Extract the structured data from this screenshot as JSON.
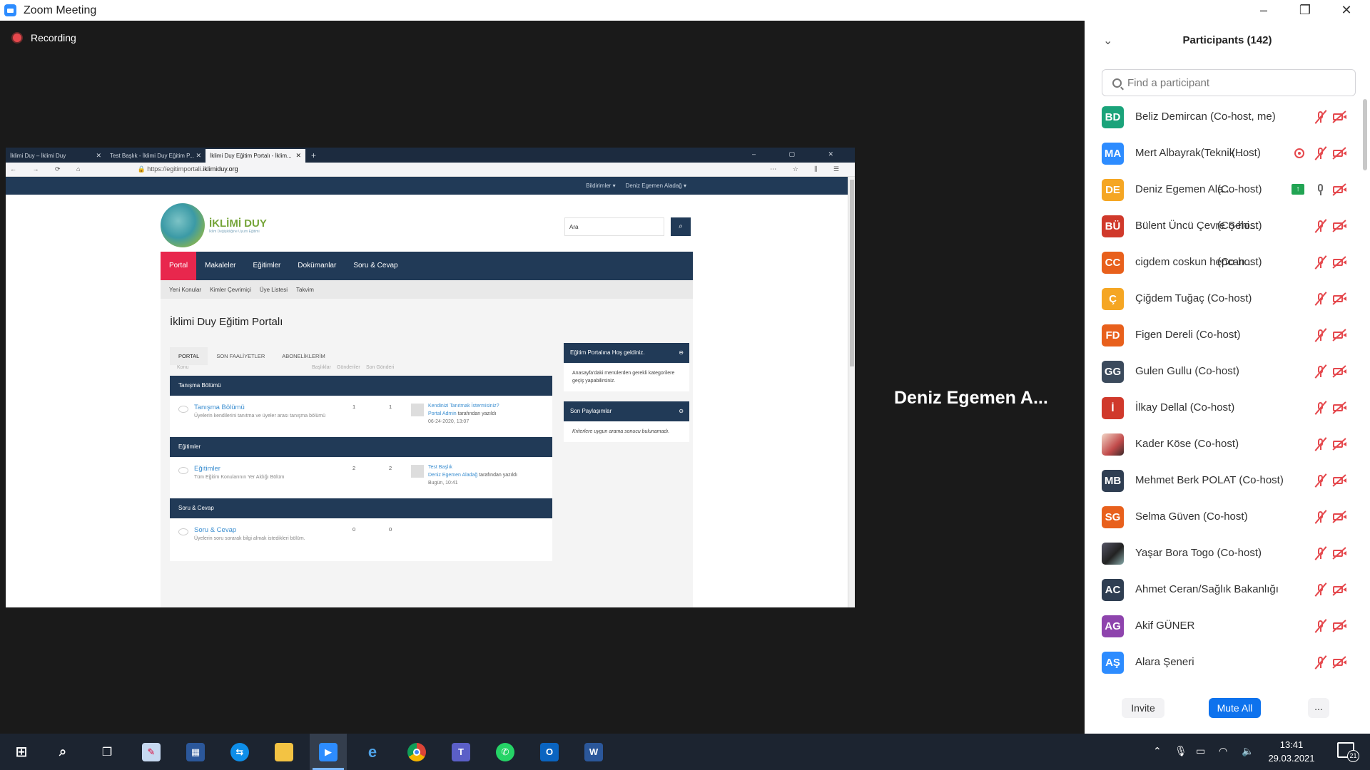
{
  "window": {
    "app_icon": "zoom-icon",
    "title": "Zoom Meeting",
    "controls": [
      "minimize-icon",
      "restore-icon",
      "close-icon"
    ]
  },
  "meeting": {
    "recording_label": "Recording",
    "active_speaker": "Deniz Egemen A..."
  },
  "shared_screen": {
    "tabs": [
      {
        "label": "İklimi Duy – İklimi Duy",
        "active": false
      },
      {
        "label": "Test Başlık - İklimi Duy Eğitim P...",
        "active": false
      },
      {
        "label": "İklimi Duy Eğitim Portalı - İklim...",
        "active": true
      }
    ],
    "url_prefix": "https://egitimportali.",
    "url_domain": "iklimiduy.org",
    "top_nav": {
      "notifications": "Bildirimler ▾",
      "user": "Deniz Egemen Aladağ ▾"
    },
    "logo": {
      "title": "İKLİMİ DUY",
      "tagline": "İklim Değişikliğine Uyum Eğitimi"
    },
    "search_value": "Ara",
    "main_nav": [
      "Portal",
      "Makaleler",
      "Eğitimler",
      "Dokümanlar",
      "Soru & Cevap"
    ],
    "sub_nav": [
      "Yeni Konular",
      "Kimler Çevrimiçi",
      "Üye Listesi",
      "Takvim"
    ],
    "page_title": "İklimi Duy Eğitim Portalı",
    "portal_tabs": [
      "PORTAL",
      "SON FAALİYETLER",
      "ABONELİKLERİM"
    ],
    "columns": [
      "Konu",
      "Başlıklar",
      "Gönderiler",
      "Son Gönderi"
    ],
    "sections": [
      {
        "title": "Tanışma Bölümü",
        "forum": "Tanışma Bölümü",
        "desc": "Üyelerin kendilerini tanıtma ve üyeler arası tanışma bölümü",
        "topics": "1",
        "posts": "1",
        "last_title": "Kendinizi Tanıtmak İstermisiniz?",
        "last_author": "Portal Admin",
        "last_by": "tarafından yazıldı",
        "last_date": "06-24-2020, 13:07"
      },
      {
        "title": "Eğitimler",
        "forum": "Eğitimler",
        "desc": "Tüm Eğitim Konularının Yer Aldığı Bölüm",
        "topics": "2",
        "posts": "2",
        "last_title": "Test Başlık",
        "last_author": "Deniz Egemen Aladağ",
        "last_by": "tarafından yazıldı",
        "last_date": "Bugün, 10:41"
      },
      {
        "title": "Soru & Cevap",
        "forum": "Soru & Cevap",
        "desc": "Üyelerin soru sorarak bilgi almak istedikleri bölüm.",
        "topics": "0",
        "posts": "0",
        "last_title": "",
        "last_author": "",
        "last_by": "",
        "last_date": ""
      }
    ],
    "sidebar": [
      {
        "title": "Eğitim Portalına Hoş geldiniz.",
        "body": "Anasayfa'daki menülerden gerekli kategorilere geçiş yapabilirsiniz."
      },
      {
        "title": "Son Paylaşımlar",
        "body": "Kriterlere uygun arama sonucu bulunamadı."
      }
    ]
  },
  "participants_panel": {
    "title": "Participants (142)",
    "search_placeholder": "Find a participant",
    "participants": [
      {
        "initials": "BD",
        "color": "#1aa37a",
        "name": "Beliz Demircan (Co-host, me)",
        "role": "",
        "mic": "muted",
        "extra": ""
      },
      {
        "initials": "MA",
        "color": "#2d8cff",
        "name": "Mert Albayrak(Teknik ...",
        "role": "(Host)",
        "mic": "muted",
        "extra": "recording"
      },
      {
        "initials": "DE",
        "color": "#f5a623",
        "name": "Deniz Egemen Ala...",
        "role": "(Co-host)",
        "mic": "on",
        "extra": "sharing"
      },
      {
        "initials": "BÜ",
        "color": "#d0392b",
        "name": "Bülent Üncü Çevre Şehi...",
        "role": "(Co-host)",
        "mic": "muted",
        "extra": ""
      },
      {
        "initials": "CC",
        "color": "#e8601c",
        "name": "cigdem coskun hepcan...",
        "role": "(Co-host)",
        "mic": "muted",
        "extra": ""
      },
      {
        "initials": "Ç",
        "color": "#f5a623",
        "name": "Çiğdem Tuğaç (Co-host)",
        "role": "",
        "mic": "muted",
        "extra": ""
      },
      {
        "initials": "FD",
        "color": "#e8601c",
        "name": "Figen Dereli (Co-host)",
        "role": "",
        "mic": "muted",
        "extra": ""
      },
      {
        "initials": "GG",
        "color": "#3b4a5c",
        "name": "Gulen Gullu (Co-host)",
        "role": "",
        "mic": "muted",
        "extra": ""
      },
      {
        "initials": "İ",
        "color": "#d0392b",
        "name": "İlkay Dellal (Co-host)",
        "role": "",
        "mic": "muted",
        "extra": ""
      },
      {
        "initials": "",
        "color": "photo",
        "name": "Kader Köse (Co-host)",
        "role": "",
        "mic": "muted",
        "extra": ""
      },
      {
        "initials": "MB",
        "color": "#2f3e52",
        "name": "Mehmet Berk POLAT  (Co-host)",
        "role": "",
        "mic": "muted",
        "extra": ""
      },
      {
        "initials": "SG",
        "color": "#e8601c",
        "name": "Selma Güven (Co-host)",
        "role": "",
        "mic": "muted",
        "extra": ""
      },
      {
        "initials": "",
        "color": "photo2",
        "name": "Yaşar Bora Togo (Co-host)",
        "role": "",
        "mic": "muted",
        "extra": ""
      },
      {
        "initials": "AC",
        "color": "#2f3e52",
        "name": "Ahmet Ceran/Sağlık Bakanlığı",
        "role": "",
        "mic": "muted",
        "extra": ""
      },
      {
        "initials": "AG",
        "color": "#8e44ad",
        "name": "Akif GÜNER",
        "role": "",
        "mic": "muted",
        "extra": ""
      },
      {
        "initials": "AŞ",
        "color": "#2d8cff",
        "name": "Alara Şeneri",
        "role": "",
        "mic": "muted",
        "extra": ""
      }
    ],
    "buttons": {
      "invite": "Invite",
      "mute_all": "Mute All",
      "more": "..."
    }
  },
  "taskbar": {
    "apps": [
      "windows-start-icon",
      "search-icon",
      "task-view-icon",
      "paint-icon",
      "calculator-icon",
      "teamviewer-icon",
      "file-explorer-icon",
      "zoom-icon",
      "internet-explorer-icon",
      "chrome-icon",
      "teams-icon",
      "whatsapp-icon",
      "outlook-icon",
      "word-icon"
    ],
    "time": "13:41",
    "date": "29.03.2021",
    "notification_count": "21"
  }
}
